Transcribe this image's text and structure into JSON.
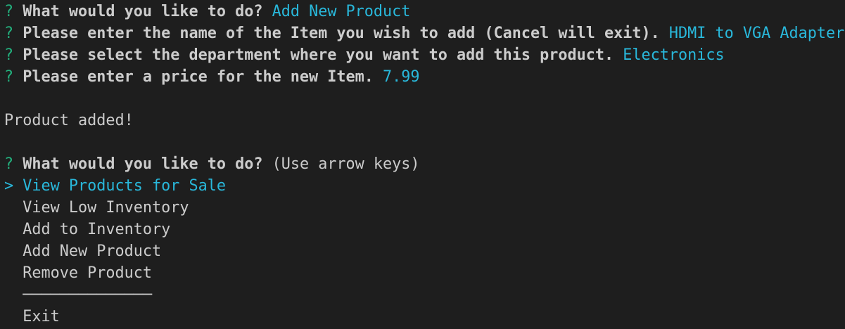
{
  "colors": {
    "background": "#1e1e1e",
    "text": "#cccccc",
    "prompt_mark": "#23b07d",
    "answer": "#29b8db"
  },
  "prompt_mark": "?",
  "history": [
    {
      "question": "What would you like to do?",
      "answer": "Add New Product"
    },
    {
      "question": "Please enter the name of the Item you wish to add (Cancel will exit).",
      "answer": "HDMI to VGA Adapter"
    },
    {
      "question": "Please select the department where you want to add this product.",
      "answer": "Electronics"
    },
    {
      "question": "Please enter a price for the new Item.",
      "answer": "7.99"
    }
  ],
  "status_message": "Product added!",
  "current_prompt": {
    "question": "What would you like to do?",
    "hint": "(Use arrow keys)"
  },
  "pointer": ">",
  "menu": {
    "items": [
      "View Products for Sale",
      "View Low Inventory",
      "Add to Inventory",
      "Add New Product",
      "Remove Product"
    ],
    "separator": "──────────────",
    "exit": "Exit",
    "selected_index": 0
  }
}
